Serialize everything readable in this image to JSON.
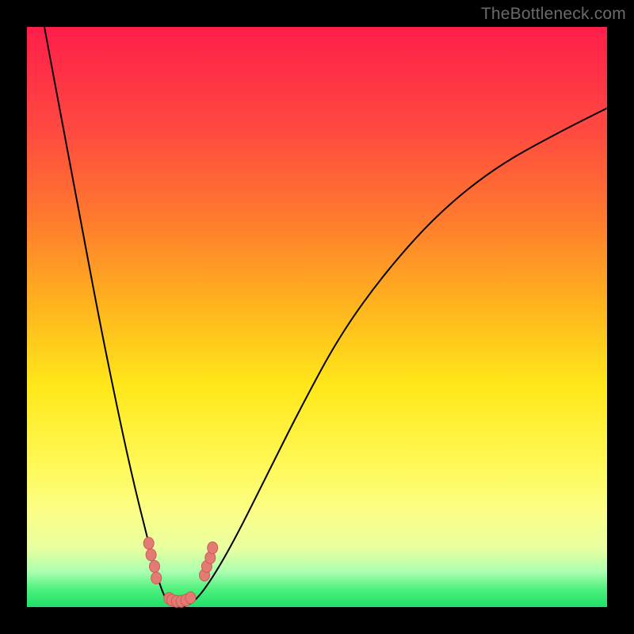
{
  "watermark": "TheBottleneck.com",
  "colors": {
    "page_bg": "#000000",
    "gradient_top": "#ff1e4a",
    "gradient_bottom": "#1fe06a",
    "curve": "#000000",
    "marker_fill": "#e47a74",
    "marker_stroke": "#cc5c54"
  },
  "chart_data": {
    "type": "line",
    "title": "",
    "xlabel": "",
    "ylabel": "",
    "xlim": [
      0,
      100
    ],
    "ylim": [
      0,
      100
    ],
    "series": [
      {
        "name": "bottleneck-curve",
        "x": [
          3,
          6,
          9,
          12,
          15,
          18,
          21,
          22.5,
          24,
          25.5,
          27,
          29,
          32,
          36,
          41,
          47,
          54,
          62,
          71,
          81,
          92,
          100
        ],
        "values": [
          100,
          84,
          68,
          52,
          37,
          23,
          11,
          5,
          1,
          0,
          0,
          1,
          5,
          12,
          22,
          34,
          47,
          58,
          68,
          76,
          82,
          86
        ]
      }
    ],
    "markers": [
      {
        "x": 21.0,
        "y": 11
      },
      {
        "x": 21.4,
        "y": 9
      },
      {
        "x": 22.0,
        "y": 7
      },
      {
        "x": 22.3,
        "y": 5
      },
      {
        "x": 24.5,
        "y": 1.5
      },
      {
        "x": 25.0,
        "y": 1.2
      },
      {
        "x": 25.8,
        "y": 1.0
      },
      {
        "x": 26.6,
        "y": 1.0
      },
      {
        "x": 27.4,
        "y": 1.2
      },
      {
        "x": 28.2,
        "y": 1.6
      },
      {
        "x": 30.6,
        "y": 5.5
      },
      {
        "x": 31.0,
        "y": 7.0
      },
      {
        "x": 31.6,
        "y": 8.5
      },
      {
        "x": 32.0,
        "y": 10.2
      }
    ],
    "annotations": []
  }
}
